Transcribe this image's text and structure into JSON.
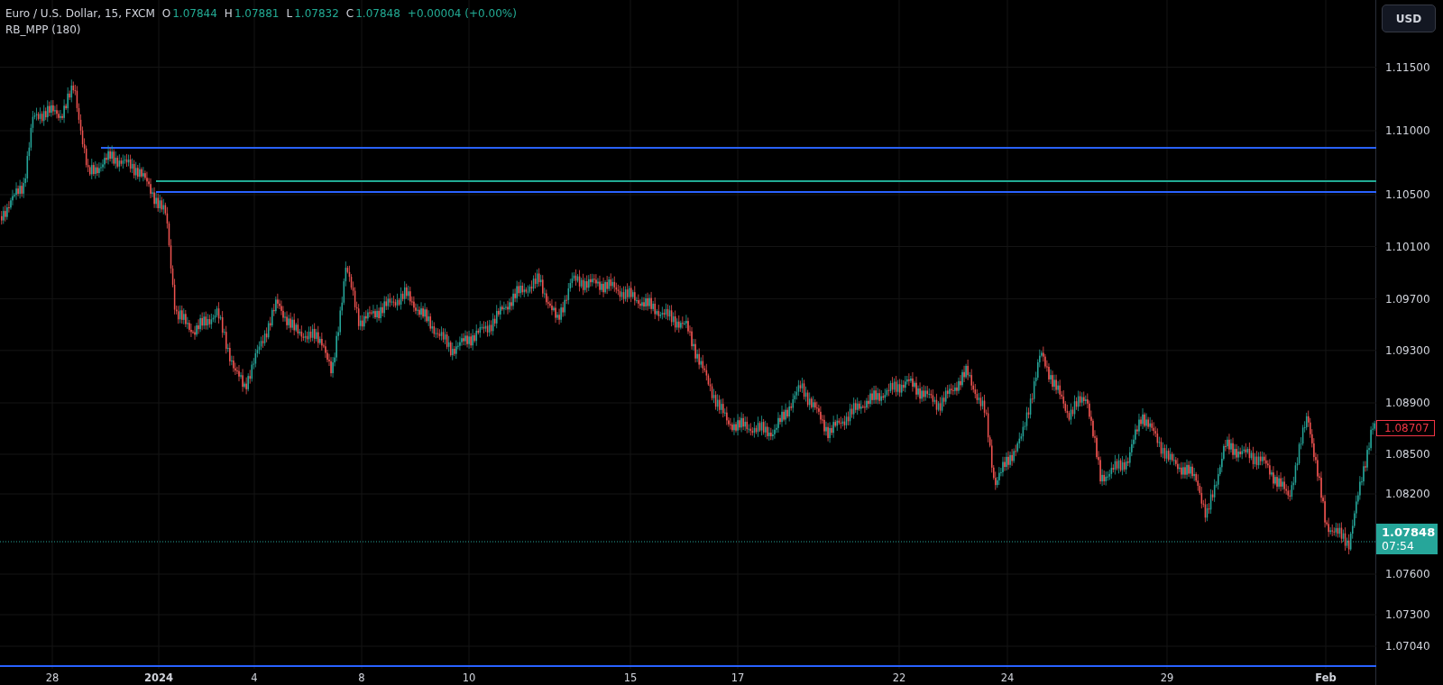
{
  "legend": {
    "symbol": "Euro / U.S. Dollar, 15, FXCM",
    "ohlc": [
      {
        "label": "O",
        "value": "1.07844"
      },
      {
        "label": "H",
        "value": "1.07881"
      },
      {
        "label": "L",
        "value": "1.07832"
      },
      {
        "label": "C",
        "value": "1.07848"
      }
    ],
    "change": "+0.00004 (+0.00%)",
    "indicator": "RB_MPP (180)"
  },
  "currency_button": "USD",
  "price_scale": [
    "1.11500",
    "1.11000",
    "1.10500",
    "1.10100",
    "1.09700",
    "1.09300",
    "1.08900",
    "1.08500",
    "1.08200",
    "1.07600",
    "1.07300",
    "1.07040"
  ],
  "price_markers": [
    {
      "kind": "outline",
      "value": "1.08707",
      "color": "#f23645"
    },
    {
      "kind": "filled",
      "value": "1.07848",
      "countdown": "07:54",
      "color": "#26a69a"
    }
  ],
  "time_scale": [
    "28",
    "2024",
    "4",
    "8",
    "10",
    "15",
    "17",
    "22",
    "24",
    "29",
    "Feb"
  ]
}
